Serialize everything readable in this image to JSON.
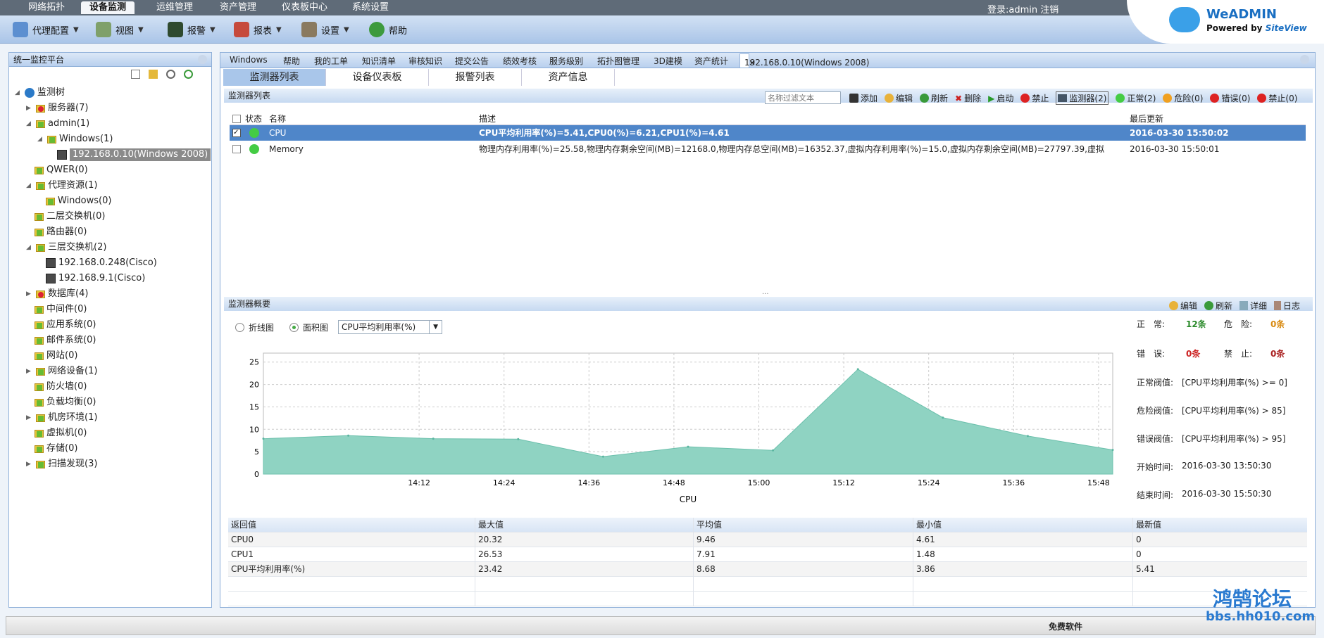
{
  "menu": [
    "网络拓扑",
    "设备监测",
    "运维管理",
    "资产管理",
    "仪表板中心",
    "系统设置"
  ],
  "login": "登录:admin  注销",
  "toolbar": [
    "代理配置",
    "视图",
    "报警",
    "报表",
    "设置",
    "帮助"
  ],
  "brand": {
    "name": "WeADMIN",
    "powered": "Powered by",
    "by": "SiteView"
  },
  "left": {
    "title": "统一监控平台",
    "tree": [
      "监测树",
      "服务器(7)",
      "admin(1)",
      "Windows(1)",
      "192.168.0.10(Windows 2008)",
      "QWER(0)",
      "代理资源(1)",
      "Windows(0)",
      "二层交换机(0)",
      "路由器(0)",
      "三层交换机(2)",
      "192.168.0.248(Cisco)",
      "192.168.9.1(Cisco)",
      "数据库(4)",
      "中间件(0)",
      "应用系统(0)",
      "邮件系统(0)",
      "网站(0)",
      "网络设备(1)",
      "防火墙(0)",
      "负载均衡(0)",
      "机房环境(1)",
      "虚拟机(0)",
      "存储(0)",
      "扫描发现(3)"
    ]
  },
  "tabs": [
    "Windows",
    "帮助",
    "我的工单",
    "知识清单",
    "审核知识",
    "提交公告",
    "绩效考核",
    "服务级别",
    "拓扑图管理",
    "3D建模",
    "资产统计",
    "192.168.0.10(Windows 2008)"
  ],
  "tab_close": "×",
  "subtabs": [
    "监测器列表",
    "设备仪表板",
    "报警列表",
    "资产信息"
  ],
  "list": {
    "title": "监测器列表",
    "filter_placeholder": "名称过滤文本",
    "actions": [
      "添加",
      "编辑",
      "刷新",
      "删除",
      "启动",
      "禁止",
      "监测器(2)",
      "正常(2)",
      "危险(0)",
      "错误(0)",
      "禁止(0)"
    ],
    "headers": [
      "状态",
      "名称",
      "描述",
      "最后更新"
    ],
    "rows": [
      {
        "name": "CPU",
        "desc": "CPU平均利用率(%)=5.41,CPU0(%)=6.21,CPU1(%)=4.61",
        "time": "2016-03-30 15:50:02"
      },
      {
        "name": "Memory",
        "desc": "物理内存利用率(%)=25.58,物理内存剩余空间(MB)=12168.0,物理内存总空间(MB)=16352.37,虚拟内存利用率(%)=15.0,虚拟内存剩余空间(MB)=27797.39,虚拟",
        "time": "2016-03-30 15:50:01"
      }
    ],
    "splitter": "..."
  },
  "overview": {
    "title": "监测器概要",
    "actions": [
      "编辑",
      "刷新",
      "详细",
      "日志"
    ],
    "radio_line": "折线图",
    "radio_area": "面积图",
    "select": "CPU平均利用率(%)",
    "stats": {
      "normal_l": "正　常:",
      "normal_v": "12条",
      "danger_l": "危　险:",
      "danger_v": "0条",
      "error_l": "错　误:",
      "error_v": "0条",
      "forbid_l": "禁　止:",
      "forbid_v": "0条",
      "th_normal_l": "正常阀值:",
      "th_normal_v": "[CPU平均利用率(%) >= 0]",
      "th_danger_l": "危险阀值:",
      "th_danger_v": "[CPU平均利用率(%) > 85]",
      "th_error_l": "错误阀值:",
      "th_error_v": "[CPU平均利用率(%) > 95]",
      "start_l": "开始时间:",
      "start_v": "2016-03-30 13:50:30",
      "end_l": "结束时间:",
      "end_v": "2016-03-30 15:50:30"
    },
    "table_headers": [
      "返回值",
      "最大值",
      "平均值",
      "最小值",
      "最新值"
    ],
    "table_rows": [
      [
        "CPU0",
        "20.32",
        "9.46",
        "4.61",
        "0"
      ],
      [
        "CPU1",
        "26.53",
        "7.91",
        "1.48",
        "0"
      ],
      [
        "CPU平均利用率(%)",
        "23.42",
        "8.68",
        "3.86",
        "5.41"
      ]
    ]
  },
  "chart_data": {
    "type": "area",
    "xlabel": "CPU",
    "ylim": [
      0,
      27
    ],
    "yticks": [
      "0",
      "5",
      "10",
      "15",
      "20",
      "25"
    ],
    "xticks": [
      "14:12",
      "14:24",
      "14:36",
      "14:48",
      "15:00",
      "15:12",
      "15:24",
      "15:36",
      "15:48"
    ],
    "x": [
      "13:50",
      "14:02",
      "14:14",
      "14:26",
      "14:38",
      "14:50",
      "15:02",
      "15:14",
      "15:26",
      "15:38",
      "15:50"
    ],
    "values": [
      7.9,
      8.6,
      7.9,
      7.8,
      3.9,
      6.1,
      5.3,
      23.4,
      12.6,
      8.5,
      5.4
    ],
    "color": "#8fd3c2"
  },
  "footer": "免费软件",
  "watermark": {
    "line1": "鸿鹄论坛",
    "line2": "bbs.hh010.com"
  }
}
